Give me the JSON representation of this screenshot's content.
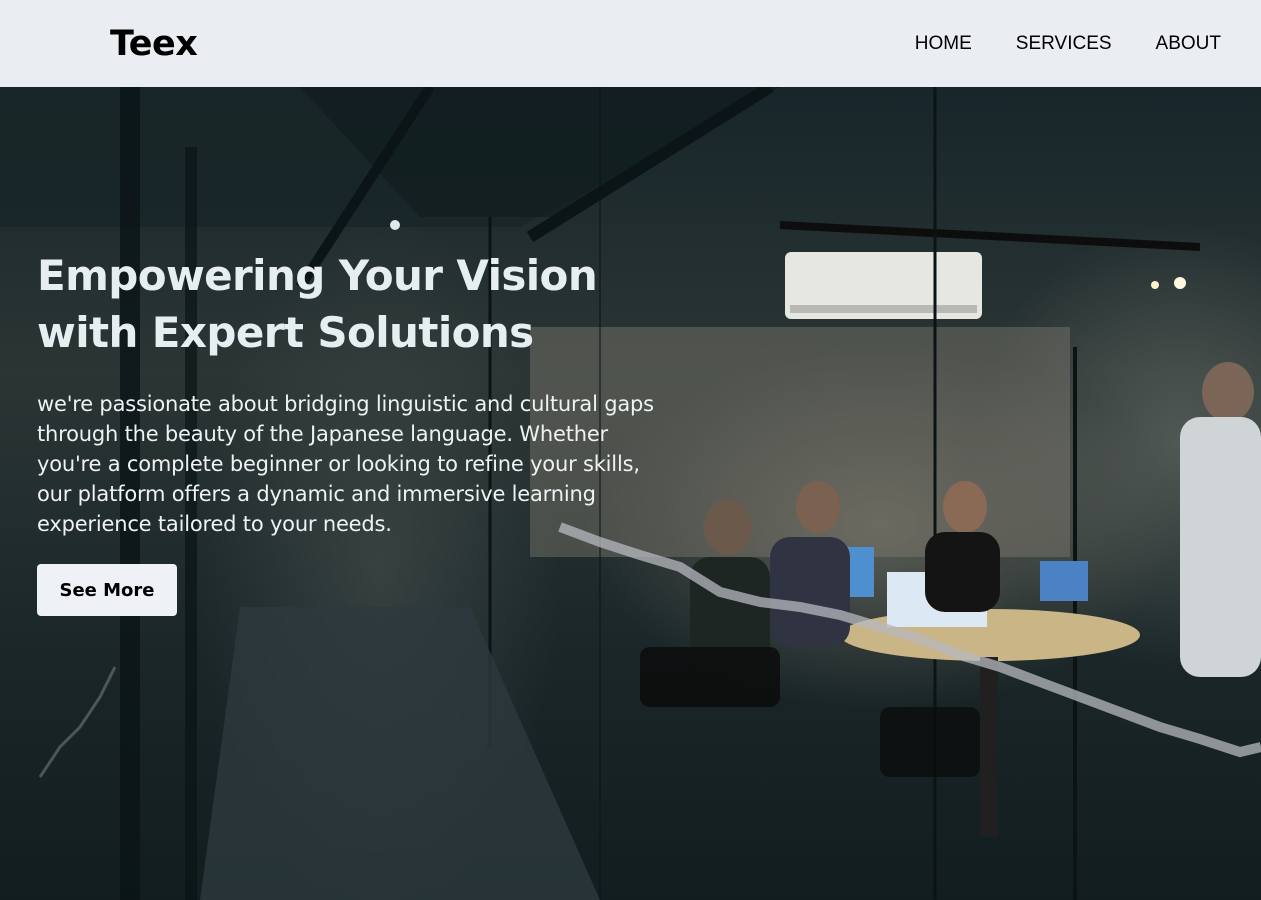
{
  "brand": {
    "name": "Teex"
  },
  "nav": {
    "items": [
      {
        "label": "HOME"
      },
      {
        "label": "SERVICES"
      },
      {
        "label": "ABOUT"
      }
    ]
  },
  "hero": {
    "title": "Empowering Your Vision with Expert Solutions",
    "description": "we're passionate about bridging linguistic and cultural gaps through the beauty of the Japanese language. Whether you're a complete beginner or looking to refine your skills, our platform offers a dynamic and immersive learning experience tailored to your needs.",
    "cta_label": "See More"
  },
  "colors": {
    "navbar_bg": "#eaeef2",
    "hero_text": "#eef2f4",
    "button_bg": "#eef2f6"
  }
}
